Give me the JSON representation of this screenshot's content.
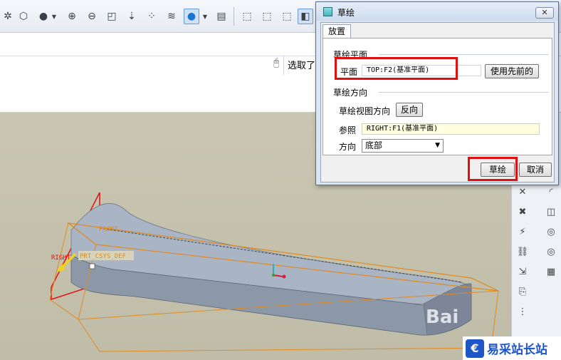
{
  "toolbar": {
    "icons": [
      "spin-center-icon",
      "view-orient-icon",
      "shading-icon",
      "dropdown-icon",
      "zoom-in-icon",
      "zoom-out-icon",
      "refit-icon",
      "datum-axis-icon",
      "datum-display-icon",
      "layers-icon",
      "appearance-icon",
      "dropdown-icon",
      "model-tree-icon",
      "wireframe-icon",
      "hidden-line-icon",
      "no-hidden-icon",
      "shaded-icon"
    ]
  },
  "message_bar": {
    "selected_text": "选取了"
  },
  "dialog": {
    "title": "草绘",
    "close_label": "✕",
    "tab_label": "放置",
    "sketch_plane": {
      "group_title": "草绘平面",
      "plane_label": "平面",
      "plane_value": "TOP:F2(基准平面)",
      "use_previous_label": "使用先前的"
    },
    "sketch_orientation": {
      "group_title": "草绘方向",
      "view_direction_label": "草绘视图方向",
      "flip_label": "反向",
      "reference_label": "参照",
      "reference_value": "RIGHT:F1(基准平面)",
      "direction_label": "方向",
      "direction_value": "底部"
    },
    "sketch_button_label": "草绘",
    "cancel_button_label": "取消"
  },
  "graphics": {
    "datum_labels": {
      "front": "FRONT",
      "right": "RIGHT",
      "csys": "PRT_CSYS_DEF"
    }
  },
  "watermark": {
    "text": "Bai",
    "site_logo_text": "易采站长站"
  },
  "colors": {
    "highlight_red": "#e01010",
    "datum_orange": "#e08a1e",
    "model_fill": "#a9b4c4",
    "dialog_bg": "#dbe6f4"
  }
}
